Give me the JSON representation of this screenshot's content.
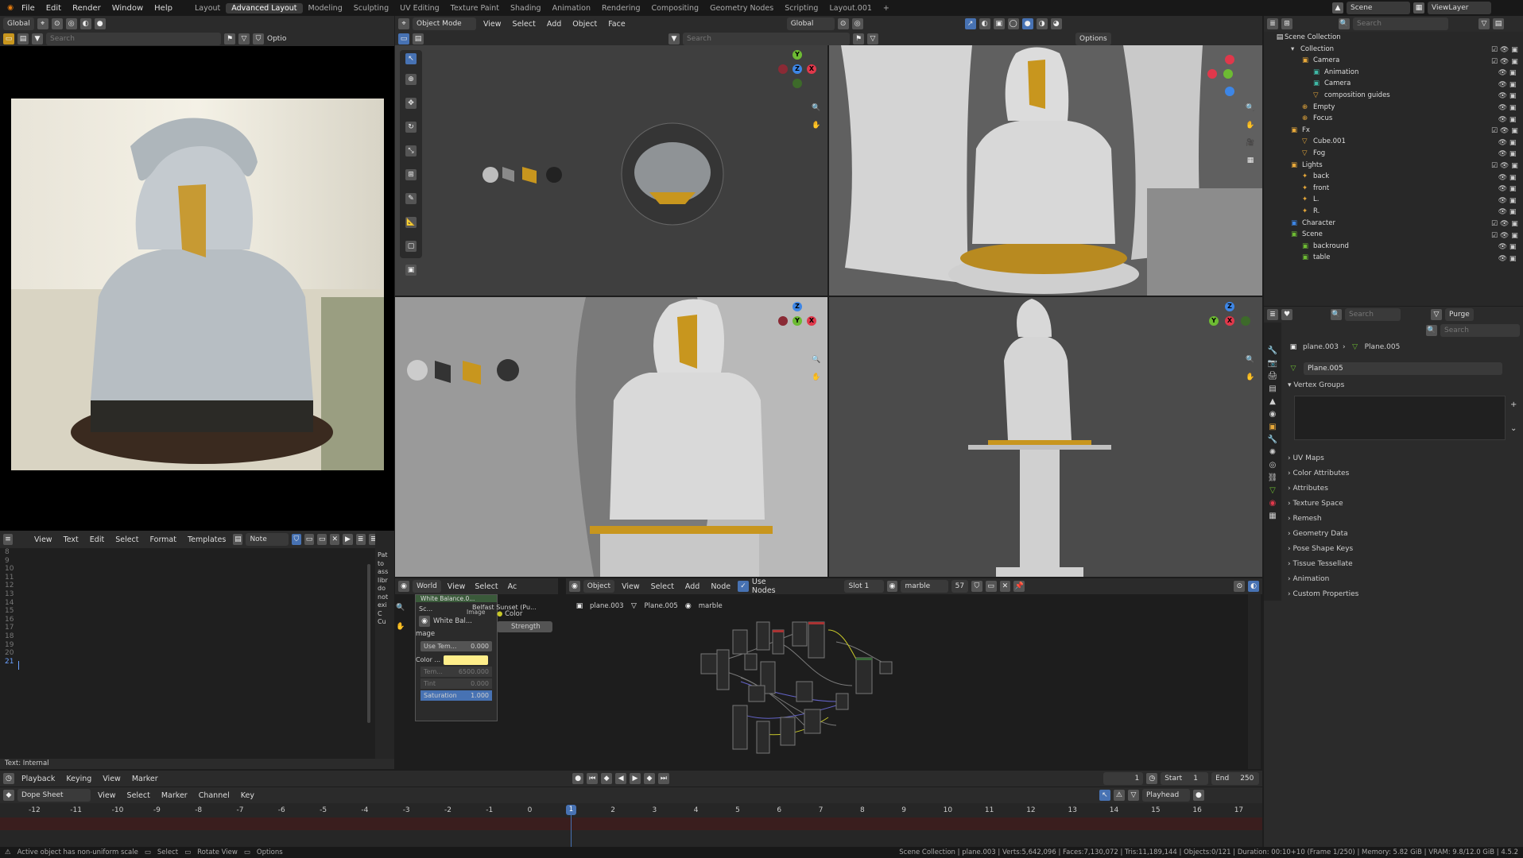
{
  "menu": {
    "file": "File",
    "edit": "Edit",
    "render": "Render",
    "window": "Window",
    "help": "Help"
  },
  "workspaces": [
    "Layout",
    "Advanced Layout",
    "Modeling",
    "Sculpting",
    "UV Editing",
    "Texture Paint",
    "Shading",
    "Animation",
    "Rendering",
    "Compositing",
    "Geometry Nodes",
    "Scripting",
    "Layout.001",
    "+"
  ],
  "scene": {
    "label": "Scene",
    "viewlayer": "ViewLayer"
  },
  "image_editor": {
    "orientation": "Global",
    "search_placeholder": "Search",
    "options": "Optio"
  },
  "viewport": {
    "mode": "Object Mode",
    "menus": [
      "View",
      "Select",
      "Add",
      "Object",
      "Face"
    ],
    "orientation": "Global",
    "search_placeholder": "Search",
    "options": "Options"
  },
  "text_editor": {
    "menus": [
      "View",
      "Text",
      "Edit",
      "Select",
      "Format",
      "Templates"
    ],
    "name": "Note",
    "line_numbers": [
      "8",
      "9",
      "10",
      "11",
      "12",
      "13",
      "14",
      "15",
      "16",
      "17",
      "18",
      "19",
      "20",
      "21"
    ],
    "status": "Text: Internal",
    "sidebar_text": [
      "Pat",
      "to",
      "ass",
      "libr",
      "do",
      "not",
      "exi",
      "C",
      "Cu"
    ]
  },
  "world_panel": {
    "type": "World",
    "menus": [
      "View",
      "Select",
      "Ac"
    ],
    "breadcrumb_a": "Sc...",
    "breadcrumb_b": "Belfast Sunset (Pu...",
    "white_balance_title": "White Balance.0...",
    "white_balance": "White Bal...",
    "image_label": "mage",
    "use_temp_label": "Use Tem...",
    "use_temp_value": "0.000",
    "color_label": "Color ...",
    "temp_label": "Tem...",
    "temp_value": "6500.000",
    "tint_label": "Tint",
    "tint_value": "0.000",
    "saturation_label": "Saturation",
    "saturation_value": "1.000",
    "color_socket": "Color",
    "strength_socket": "Strength",
    "image_socket": "Image"
  },
  "node_editor": {
    "type": "Object",
    "menus": [
      "View",
      "Select",
      "Add",
      "Node"
    ],
    "use_nodes": "Use Nodes",
    "slot": "Slot 1",
    "material": "marble",
    "users": "57",
    "breadcrumb": [
      "plane.003",
      "Plane.005",
      "marble"
    ]
  },
  "outliner": {
    "search_placeholder": "Search",
    "root": "Scene Collection",
    "items": [
      {
        "name": "Collection",
        "depth": 1
      },
      {
        "name": "Camera",
        "depth": 2
      },
      {
        "name": "Animation",
        "depth": 3
      },
      {
        "name": "Camera",
        "depth": 3
      },
      {
        "name": "composition guides",
        "depth": 3
      },
      {
        "name": "Empty",
        "depth": 2
      },
      {
        "name": "Focus",
        "depth": 2
      },
      {
        "name": "Fx",
        "depth": 1
      },
      {
        "name": "Cube.001",
        "depth": 2
      },
      {
        "name": "Fog",
        "depth": 2
      },
      {
        "name": "Lights",
        "depth": 1
      },
      {
        "name": "back",
        "depth": 2
      },
      {
        "name": "front",
        "depth": 2
      },
      {
        "name": "L.",
        "depth": 2
      },
      {
        "name": "R.",
        "depth": 2
      },
      {
        "name": "Character",
        "depth": 1
      },
      {
        "name": "Scene",
        "depth": 1
      },
      {
        "name": "backround",
        "depth": 2
      },
      {
        "name": "table",
        "depth": 2
      }
    ]
  },
  "properties": {
    "search_placeholder": "Search",
    "purge": "Purge",
    "object": "plane.003",
    "mesh": "Plane.005",
    "mesh_field": "Plane.005",
    "sections": [
      "Vertex Groups",
      "UV Maps",
      "Color Attributes",
      "Attributes",
      "Texture Space",
      "Remesh",
      "Geometry Data",
      "Pose Shape Keys",
      "Tissue Tessellate",
      "Animation",
      "Custom Properties"
    ]
  },
  "playback": {
    "menus": [
      "Playback",
      "Keying",
      "View",
      "Marker"
    ],
    "current_frame": "1",
    "start_label": "Start",
    "start": "1",
    "end_label": "End",
    "end": "250"
  },
  "dopesheet": {
    "mode": "Dope Sheet",
    "menus": [
      "View",
      "Select",
      "Marker",
      "Channel",
      "Key"
    ],
    "playhead": "Playhead",
    "ticks": [
      "-12",
      "-11",
      "-10",
      "-9",
      "-8",
      "-7",
      "-6",
      "-5",
      "-4",
      "-3",
      "-2",
      "-1",
      "0",
      "1",
      "2",
      "3",
      "4",
      "5",
      "6",
      "7",
      "8",
      "9",
      "10",
      "11",
      "12",
      "13",
      "14",
      "15",
      "16",
      "17"
    ],
    "current": "1"
  },
  "statusbar": {
    "left": [
      "Active object has non-uniform scale",
      "Select",
      "Rotate View",
      "Options"
    ],
    "right": "Scene Collection | plane.003 | Verts:5,642,096 | Faces:7,130,072 | Tris:11,189,144 | Objects:0/121 | Duration: 00:10+10 (Frame 1/250) | Memory: 5.82 GiB | VRAM: 9.8/12.0 GiB | 4.5.2"
  },
  "colors": {
    "accent": "#4772b3",
    "gold": "#c8961e",
    "bg": "#1d1d1d",
    "panel": "#303030",
    "header": "#2b2b2b",
    "viewport": "#3d3d3d"
  }
}
